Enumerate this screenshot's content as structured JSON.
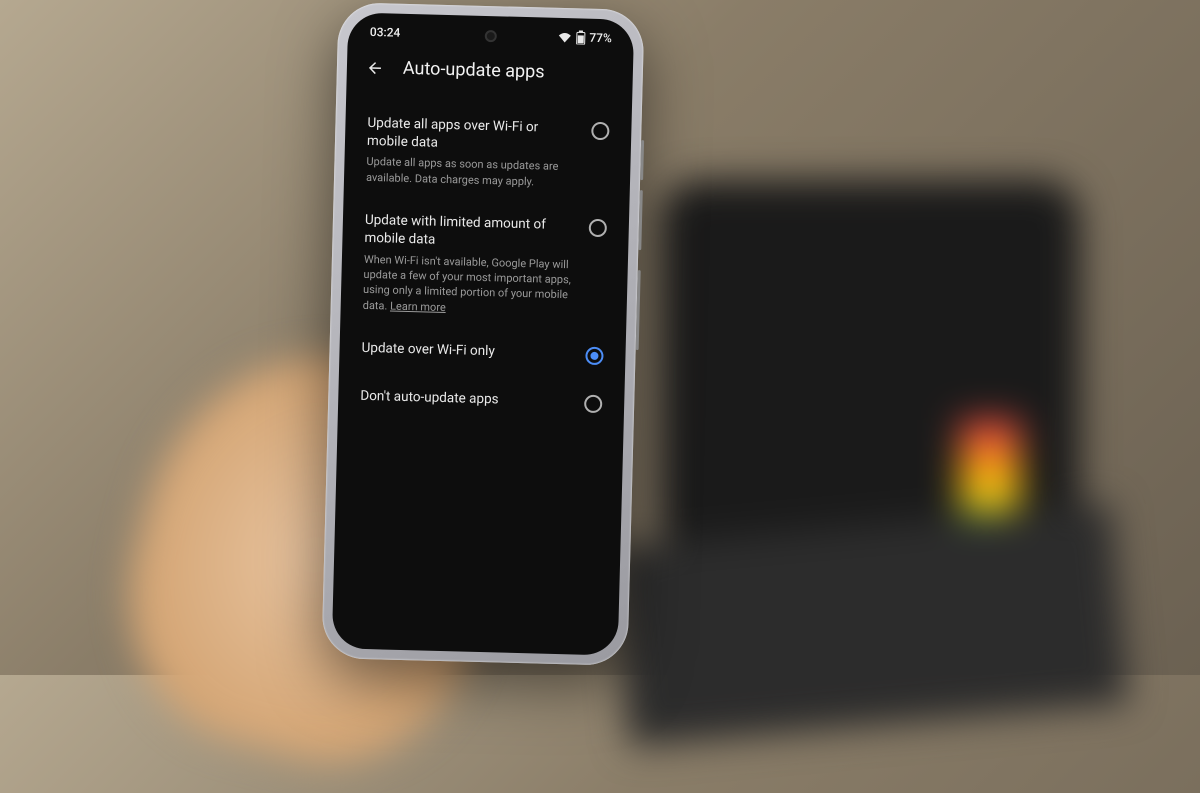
{
  "status": {
    "time": "03:24",
    "battery_pct": "77%"
  },
  "header": {
    "title": "Auto-update apps"
  },
  "options": [
    {
      "title": "Update all apps over Wi-Fi or mobile data",
      "desc": "Update all apps as soon as updates are available. Data charges may apply.",
      "selected": false
    },
    {
      "title": "Update with limited amount of mobile data",
      "desc": "When Wi-Fi isn't available, Google Play will update a few of your most important apps, using only a limited portion of your mobile data.",
      "learn_more": "Learn more",
      "selected": false
    },
    {
      "title": "Update over Wi-Fi only",
      "desc": "",
      "selected": true
    },
    {
      "title": "Don't auto-update apps",
      "desc": "",
      "selected": false
    }
  ]
}
